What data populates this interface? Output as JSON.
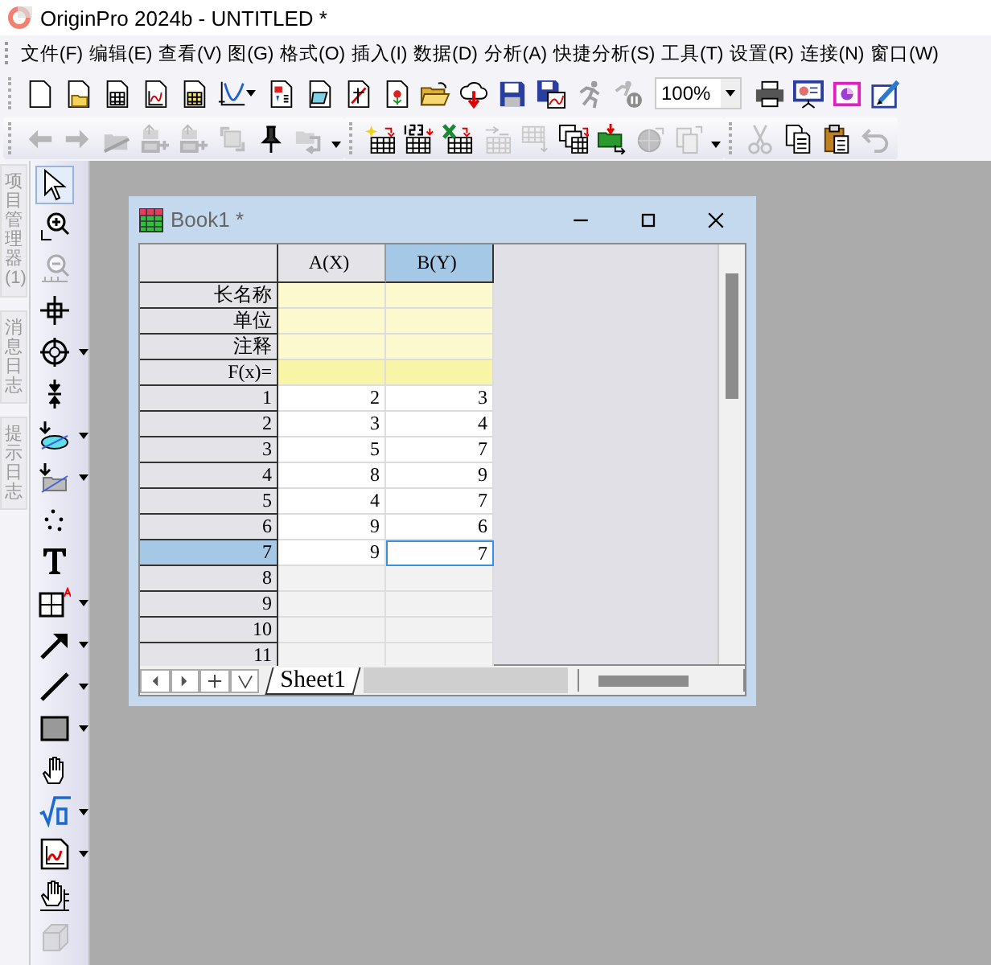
{
  "window": {
    "title": "OriginPro 2024b - UNTITLED *"
  },
  "menu": [
    "文件(F)",
    "编辑(E)",
    "查看(V)",
    "图(G)",
    "格式(O)",
    "插入(I)",
    "数据(D)",
    "分析(A)",
    "快捷分析(S)",
    "工具(T)",
    "设置(R)",
    "连接(N)",
    "窗口(W)"
  ],
  "toolbar_1": [
    {
      "kind": "button",
      "disabled": false
    },
    {
      "kind": "button",
      "disabled": false
    },
    {
      "kind": "button",
      "disabled": false
    },
    {
      "kind": "button",
      "disabled": false
    },
    {
      "kind": "button",
      "disabled": false
    },
    {
      "kind": "button",
      "disabled": false
    },
    {
      "kind": "button",
      "disabled": false
    },
    {
      "kind": "button",
      "disabled": false
    },
    {
      "kind": "button",
      "disabled": false
    },
    {
      "kind": "button",
      "disabled": false
    },
    {
      "kind": "button",
      "disabled": false
    },
    {
      "kind": "button",
      "disabled": false
    },
    {
      "kind": "button",
      "disabled": false
    },
    {
      "kind": "button",
      "disabled": false
    },
    {
      "kind": "button",
      "disabled": true
    },
    {
      "kind": "button",
      "disabled": true
    },
    {
      "kind": "combo",
      "value": "100%"
    },
    {
      "kind": "button",
      "disabled": false
    },
    {
      "kind": "button",
      "disabled": false
    },
    {
      "kind": "button",
      "disabled": false
    },
    {
      "kind": "button",
      "disabled": false
    }
  ],
  "toolbar_2": [
    {
      "disabled": true
    },
    {
      "disabled": true
    },
    {
      "disabled": true
    },
    {
      "disabled": true
    },
    {
      "disabled": true
    },
    {
      "disabled": true
    },
    {
      "disabled": false
    },
    {
      "disabled": true
    },
    {
      "disabled": false
    },
    {
      "disabled": false
    },
    {
      "disabled": false
    },
    {
      "disabled": true
    },
    {
      "disabled": true
    },
    {
      "disabled": false
    },
    {
      "disabled": false
    },
    {
      "disabled": true
    },
    {
      "disabled": true
    },
    {
      "disabled": true
    },
    {
      "disabled": false
    },
    {
      "disabled": false
    },
    {
      "disabled": true
    }
  ],
  "side_tabs": [
    "项目管理器 (1)",
    "消息日志",
    "提示日志"
  ],
  "tools": [
    {
      "selected": true,
      "disabled": false
    },
    {
      "selected": false,
      "disabled": false
    },
    {
      "selected": false,
      "disabled": true
    },
    {
      "selected": false,
      "disabled": false
    },
    {
      "selected": false,
      "disabled": false
    },
    {
      "selected": false,
      "disabled": false
    },
    {
      "selected": false,
      "disabled": false
    },
    {
      "selected": false,
      "disabled": false
    },
    {
      "selected": false,
      "disabled": false
    },
    {
      "selected": false,
      "disabled": false
    },
    {
      "selected": false,
      "disabled": false
    },
    {
      "selected": false,
      "disabled": false
    },
    {
      "selected": false,
      "disabled": false
    },
    {
      "selected": false,
      "disabled": false
    },
    {
      "selected": false,
      "disabled": false
    },
    {
      "selected": false,
      "disabled": false
    },
    {
      "selected": false,
      "disabled": false
    },
    {
      "selected": false,
      "disabled": false
    },
    {
      "selected": false,
      "disabled": true
    }
  ],
  "workbook": {
    "title": "Book1 *",
    "columns": [
      {
        "label": "A(X)",
        "selected": false
      },
      {
        "label": "B(Y)",
        "selected": true
      }
    ],
    "label_rows": [
      "长名称",
      "单位",
      "注释",
      "F(x)="
    ],
    "rows": [
      {
        "label": "1",
        "selected": false,
        "cells": [
          {
            "value": "2",
            "active": false
          },
          {
            "value": "3",
            "active": false
          }
        ]
      },
      {
        "label": "2",
        "selected": false,
        "cells": [
          {
            "value": "3",
            "active": false
          },
          {
            "value": "4",
            "active": false
          }
        ]
      },
      {
        "label": "3",
        "selected": false,
        "cells": [
          {
            "value": "5",
            "active": false
          },
          {
            "value": "7",
            "active": false
          }
        ]
      },
      {
        "label": "4",
        "selected": false,
        "cells": [
          {
            "value": "8",
            "active": false
          },
          {
            "value": "9",
            "active": false
          }
        ]
      },
      {
        "label": "5",
        "selected": false,
        "cells": [
          {
            "value": "4",
            "active": false
          },
          {
            "value": "7",
            "active": false
          }
        ]
      },
      {
        "label": "6",
        "selected": false,
        "cells": [
          {
            "value": "9",
            "active": false
          },
          {
            "value": "6",
            "active": false
          }
        ]
      },
      {
        "label": "7",
        "selected": true,
        "cells": [
          {
            "value": "9",
            "active": false
          },
          {
            "value": "7",
            "active": true
          }
        ]
      },
      {
        "label": "8",
        "selected": false
      },
      {
        "label": "9",
        "selected": false
      },
      {
        "label": "10",
        "selected": false
      },
      {
        "label": "11",
        "selected": false
      }
    ],
    "sheets": [
      {
        "label": "Sheet1",
        "selected": true
      }
    ]
  }
}
